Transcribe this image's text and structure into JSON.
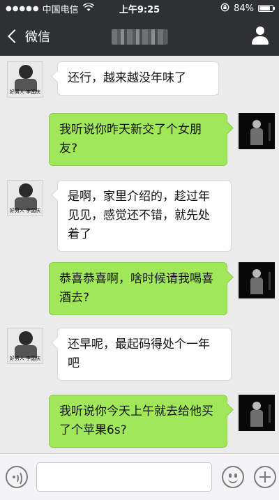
{
  "status_bar": {
    "signal": "●●●●●",
    "carrier": "中国电信",
    "wifi_icon": "wifi-icon",
    "time": "上午9:25",
    "battery_percent": "84%",
    "battery_level": 0.84
  },
  "nav": {
    "back_label": "微信",
    "profile_icon": "person-icon"
  },
  "messages": [
    {
      "side": "left",
      "text": "还行，越来越没年味了",
      "avatar_caption": "好男人 李国庆"
    },
    {
      "side": "right",
      "text": "我听说你昨天新交了个女朋友?"
    },
    {
      "side": "left",
      "text": "是啊，家里介绍的，趁过年见见，感觉还不错，就先处着了",
      "avatar_caption": "好男人 李国庆"
    },
    {
      "side": "right",
      "text": "恭喜恭喜啊，啥时候请我喝喜酒去?"
    },
    {
      "side": "left",
      "text": "还早呢，最起码得处个一年吧",
      "avatar_caption": "好男人 李国庆"
    },
    {
      "side": "right",
      "text": "我听说你今天上午就去给他买了个苹果6s?"
    }
  ],
  "input_bar": {
    "voice_icon": "voice-icon",
    "emoji_icon": "emoji-icon",
    "plus_icon": "plus-icon",
    "input_value": ""
  },
  "colors": {
    "nav_background": "#2e3132",
    "chat_background": "#ebebeb",
    "sent_bubble": "#a0e75a",
    "received_bubble": "#ffffff"
  }
}
